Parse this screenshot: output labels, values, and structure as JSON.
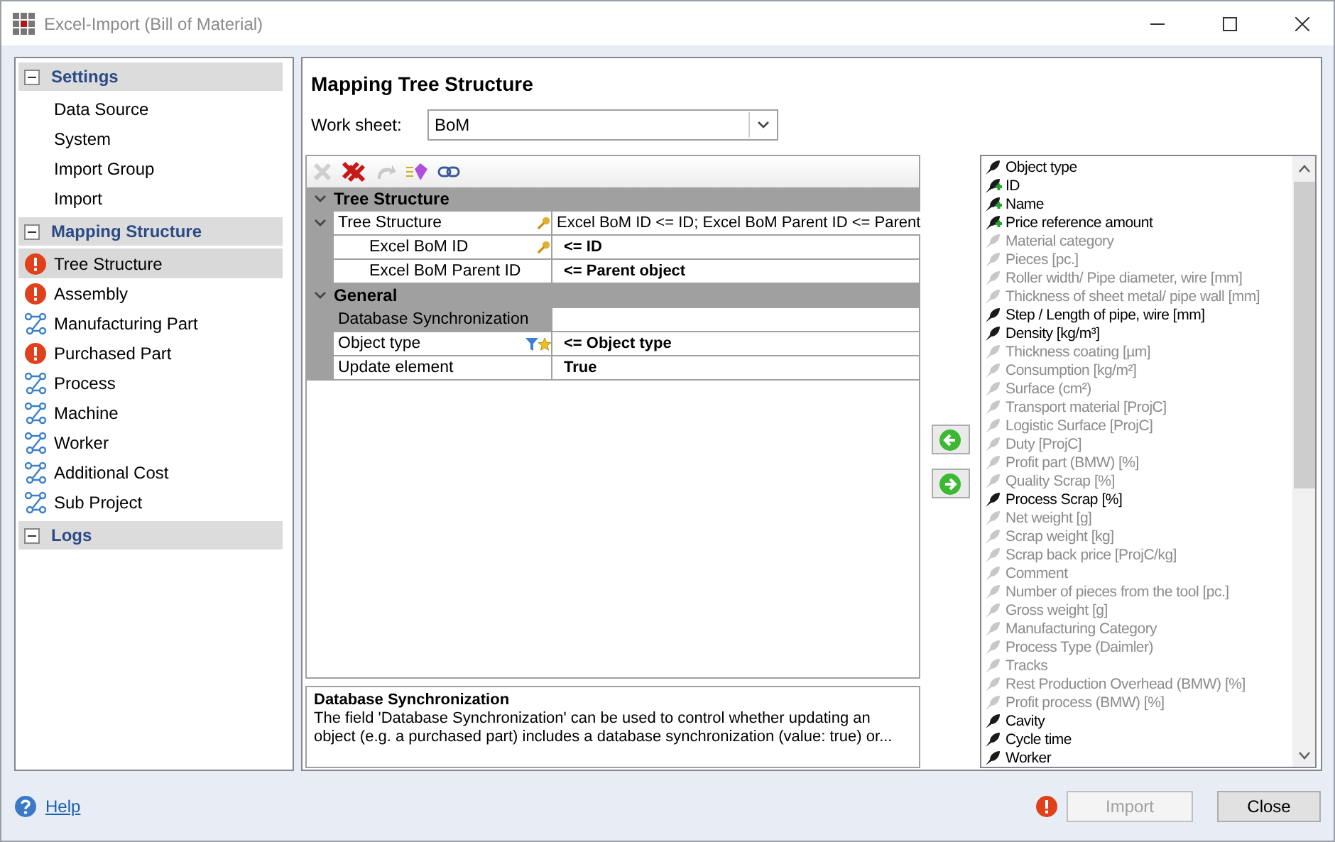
{
  "window": {
    "title": "Excel-Import (Bill of Material)"
  },
  "sidebar": {
    "groups": [
      {
        "title": "Settings",
        "expanded": true,
        "items": [
          {
            "label": "Data Source",
            "kind": "plain",
            "selected": false
          },
          {
            "label": "System",
            "kind": "plain",
            "selected": false
          },
          {
            "label": "Import Group",
            "kind": "plain",
            "selected": false
          },
          {
            "label": "Import",
            "kind": "plain",
            "selected": false
          }
        ]
      },
      {
        "title": "Mapping Structure",
        "expanded": true,
        "items": [
          {
            "label": "Tree Structure",
            "kind": "error",
            "selected": true
          },
          {
            "label": "Assembly",
            "kind": "error",
            "selected": false
          },
          {
            "label": "Manufacturing Part",
            "kind": "mapping",
            "selected": false
          },
          {
            "label": "Purchased Part",
            "kind": "error",
            "selected": false
          },
          {
            "label": "Process",
            "kind": "mapping",
            "selected": false
          },
          {
            "label": "Machine",
            "kind": "mapping",
            "selected": false
          },
          {
            "label": "Worker",
            "kind": "mapping",
            "selected": false
          },
          {
            "label": "Additional Cost",
            "kind": "mapping",
            "selected": false
          },
          {
            "label": "Sub Project",
            "kind": "mapping",
            "selected": false
          }
        ]
      },
      {
        "title": "Logs",
        "expanded": true
      }
    ]
  },
  "main": {
    "title": "Mapping Tree Structure",
    "worksheet": {
      "label": "Work sheet:",
      "value": "BoM"
    },
    "toolbar": [
      {
        "kind": "remove",
        "disabled": true
      },
      {
        "kind": "remove-all",
        "disabled": false
      },
      {
        "kind": "reset",
        "disabled": true
      },
      {
        "kind": "add",
        "disabled": false
      },
      {
        "kind": "link",
        "disabled": false
      }
    ],
    "grid": [
      {
        "title": "Tree Structure",
        "expanded": true,
        "rows": [
          {
            "label": "Tree Structure",
            "key": true,
            "filtered": false,
            "favorite": false,
            "value": "Excel BoM ID <= ID; Excel BoM Parent ID <= Parent",
            "modified": false,
            "selected": false,
            "expanded": true,
            "children": [
              {
                "label": "Excel BoM ID",
                "key": true,
                "filtered": false,
                "favorite": false,
                "value": "<= ID",
                "modified": true,
                "selected": false
              },
              {
                "label": "Excel BoM Parent ID",
                "key": false,
                "filtered": false,
                "favorite": false,
                "value": "<= Parent object",
                "modified": true,
                "selected": false
              }
            ]
          }
        ]
      },
      {
        "title": "General",
        "expanded": true,
        "rows": [
          {
            "label": "Database Synchronization",
            "key": false,
            "filtered": false,
            "favorite": false,
            "modified": false,
            "selected": true
          },
          {
            "label": "Object type",
            "key": false,
            "filtered": true,
            "favorite": true,
            "value": "<= Object type",
            "modified": true,
            "selected": false
          },
          {
            "label": "Update element",
            "key": false,
            "filtered": false,
            "favorite": false,
            "value": "True",
            "modified": true,
            "selected": false
          }
        ]
      }
    ],
    "description": {
      "title": "Database Synchronization",
      "text": "The field 'Database Synchronization' can be used to control whether updating an object (e.g. a purchased part) includes a database synchronization (value: true) or..."
    },
    "fields": [
      {
        "label": "Object type",
        "mapped": true,
        "required": false
      },
      {
        "label": "ID",
        "mapped": true,
        "required": true
      },
      {
        "label": "Name",
        "mapped": true,
        "required": true
      },
      {
        "label": "Price reference amount",
        "mapped": true,
        "required": true
      },
      {
        "label": "Material category",
        "mapped": false,
        "required": false
      },
      {
        "label": "Pieces [pc.]",
        "mapped": false,
        "required": false
      },
      {
        "label": "Roller width/ Pipe diameter, wire [mm]",
        "mapped": false,
        "required": false
      },
      {
        "label": "Thickness of sheet metal/ pipe wall [mm]",
        "mapped": false,
        "required": false
      },
      {
        "label": "Step / Length of pipe, wire [mm]",
        "mapped": true,
        "required": false
      },
      {
        "label": "Density [kg/m³]",
        "mapped": true,
        "required": false
      },
      {
        "label": "Thickness coating [µm]",
        "mapped": false,
        "required": false
      },
      {
        "label": "Consumption [kg/m²]",
        "mapped": false,
        "required": false
      },
      {
        "label": "Surface (cm²)",
        "mapped": false,
        "required": false
      },
      {
        "label": "Transport material [ProjC]",
        "mapped": false,
        "required": false
      },
      {
        "label": "Logistic Surface [ProjC]",
        "mapped": false,
        "required": false
      },
      {
        "label": "Duty [ProjC]",
        "mapped": false,
        "required": false
      },
      {
        "label": "Profit part (BMW) [%]",
        "mapped": false,
        "required": false
      },
      {
        "label": "Quality Scrap [%]",
        "mapped": false,
        "required": false
      },
      {
        "label": "Process Scrap [%]",
        "mapped": true,
        "required": false
      },
      {
        "label": "Net weight [g]",
        "mapped": false,
        "required": false
      },
      {
        "label": "Scrap weight [kg]",
        "mapped": false,
        "required": false
      },
      {
        "label": "Scrap back price [ProjC/kg]",
        "mapped": false,
        "required": false
      },
      {
        "label": "Comment",
        "mapped": false,
        "required": false
      },
      {
        "label": "Number of pieces from the tool [pc.]",
        "mapped": false,
        "required": false
      },
      {
        "label": "Gross weight [g]",
        "mapped": false,
        "required": false
      },
      {
        "label": "Manufacturing Category",
        "mapped": false,
        "required": false
      },
      {
        "label": "Process Type (Daimler)",
        "mapped": false,
        "required": false
      },
      {
        "label": "Tracks",
        "mapped": false,
        "required": false
      },
      {
        "label": "Rest Production Overhead (BMW) [%]",
        "mapped": false,
        "required": false
      },
      {
        "label": "Profit process (BMW) [%]",
        "mapped": false,
        "required": false
      },
      {
        "label": "Cavity",
        "mapped": true,
        "required": false
      },
      {
        "label": "Cycle time",
        "mapped": true,
        "required": false
      },
      {
        "label": "Worker",
        "mapped": true,
        "required": false
      }
    ]
  },
  "footer": {
    "help": "Help",
    "import": {
      "label": "Import",
      "disabled": true
    },
    "close": {
      "label": "Close",
      "disabled": false
    }
  }
}
